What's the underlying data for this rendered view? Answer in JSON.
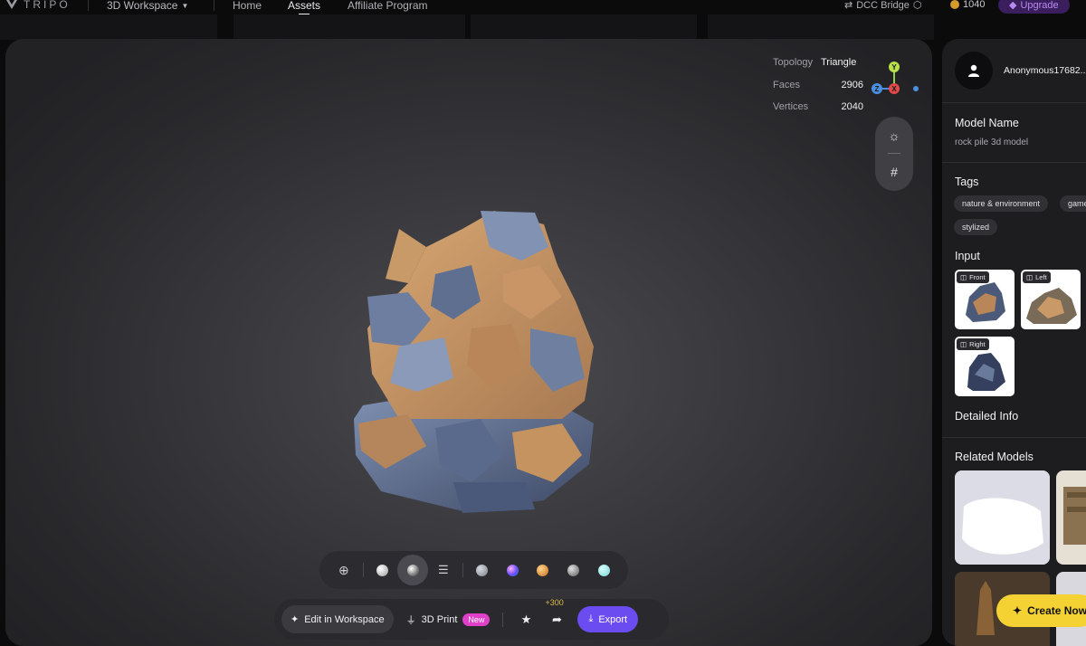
{
  "header": {
    "logo_text": "TRIPO",
    "workspace_label": "3D Workspace",
    "nav": [
      {
        "label": "Home"
      },
      {
        "label": "Assets"
      },
      {
        "label": "Affiliate Program"
      }
    ],
    "dcc_label": "DCC Bridge",
    "credits": "1040",
    "upgrade_label": "Upgrade"
  },
  "viewer": {
    "stats": [
      {
        "key": "Topology",
        "value": "Triangle"
      },
      {
        "key": "Faces",
        "value": "2906"
      },
      {
        "key": "Vertices",
        "value": "2040"
      }
    ],
    "gizmo": {
      "y": "Y",
      "x": "X",
      "z": "Z"
    },
    "materials": [
      {
        "icon": "wireframe-globe-icon"
      },
      {
        "icon": "clay-material-icon",
        "color": "#d9d9d9"
      },
      {
        "icon": "textured-material-icon",
        "color": "#cfcfcf",
        "selected": true
      },
      {
        "icon": "adjust-sliders-icon"
      },
      {
        "icon": "gray-matcap-icon",
        "color": "#9a9ea6"
      },
      {
        "icon": "iridescent-matcap-icon",
        "color": "#8a6cff"
      },
      {
        "icon": "gold-matcap-icon",
        "color": "#d8882a"
      },
      {
        "icon": "dark-matcap-icon",
        "color": "#8e8e8e"
      },
      {
        "icon": "cyan-matcap-icon",
        "color": "#8fe3e3"
      }
    ],
    "actions": {
      "edit_label": "Edit in Workspace",
      "print_label": "3D Print",
      "new_badge": "New",
      "share_bonus": "+300",
      "export_label": "Export"
    }
  },
  "panel": {
    "username": "Anonymous17682...",
    "model_name_heading": "Model Name",
    "model_name": "rock pile 3d model",
    "tags_heading": "Tags",
    "tags": [
      "nature & environment",
      "game",
      "stylized"
    ],
    "input_heading": "Input",
    "inputs": [
      {
        "label": "Front"
      },
      {
        "label": "Left"
      },
      {
        "label": "Right"
      }
    ],
    "detailed_info_heading": "Detailed Info",
    "related_heading": "Related Models",
    "create_now_label": "Create Now"
  }
}
